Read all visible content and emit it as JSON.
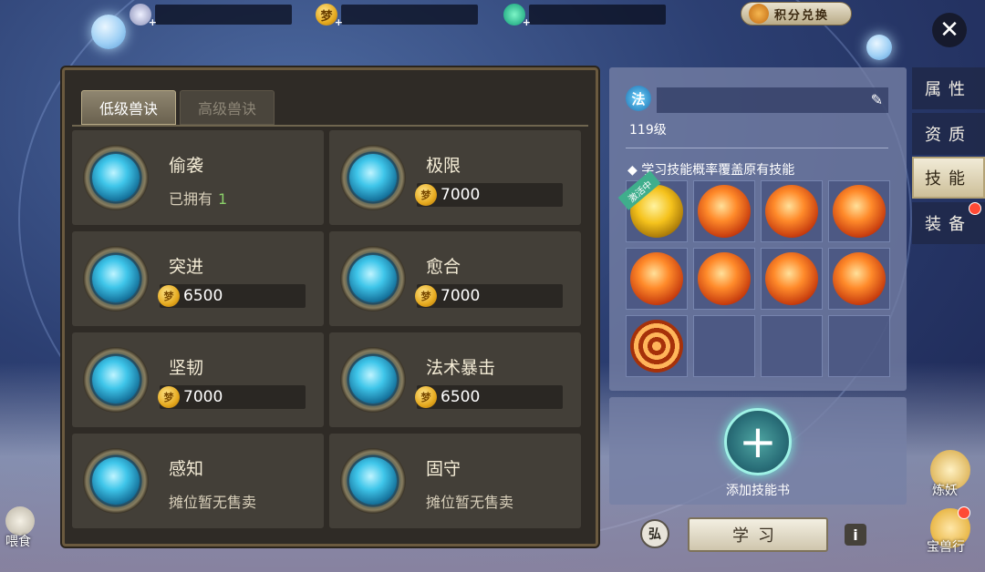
{
  "header": {
    "currency_1_icon": "silver-coin-icon",
    "currency_2_icon": "gold-dream-coin-icon",
    "currency_3_icon": "jade-coin-icon",
    "exchange_label": "积分兑换",
    "close_label": "✕"
  },
  "tabs": [
    {
      "label": "低级兽诀",
      "active": true
    },
    {
      "label": "高级兽诀",
      "active": false
    }
  ],
  "skill_cards": [
    {
      "name": "偷袭",
      "status": "已拥有",
      "owned_count": "1"
    },
    {
      "name": "极限",
      "price": "7000"
    },
    {
      "name": "突进",
      "price": "6500"
    },
    {
      "name": "愈合",
      "price": "7000"
    },
    {
      "name": "坚韧",
      "price": "7000"
    },
    {
      "name": "法术暴击",
      "price": "6500"
    },
    {
      "name": "感知",
      "status": "摊位暂无售卖"
    },
    {
      "name": "固守",
      "status": "摊位暂无售卖"
    }
  ],
  "coin_glyph": "梦",
  "pet": {
    "type_badge": "法",
    "level": "119级",
    "hint": "◆ 学习技能概率覆盖原有技能",
    "active_tag": "激活中",
    "brush_icon": "✎"
  },
  "book": {
    "add_symbol": "+",
    "label": "添加技能书"
  },
  "actions": {
    "auto_label": "弘",
    "learn_label": "学习",
    "info_label": "i"
  },
  "side_tabs": [
    {
      "label": "属性",
      "active": false
    },
    {
      "label": "资质",
      "active": false
    },
    {
      "label": "技能",
      "active": true
    },
    {
      "label": "装备",
      "active": false,
      "badge": true
    }
  ],
  "shortcuts": {
    "feed_label": "喂食",
    "refine_label": "炼妖",
    "treasure_label": "宝兽行"
  }
}
